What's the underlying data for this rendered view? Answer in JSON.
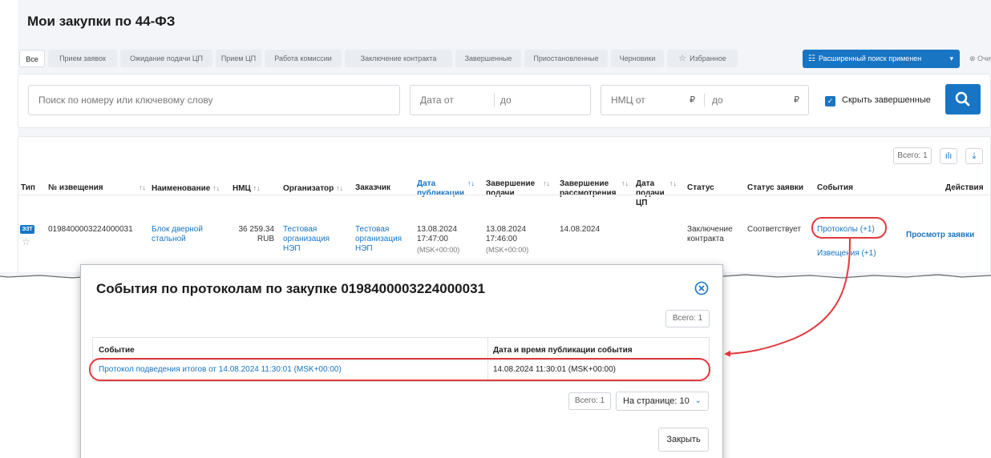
{
  "page": {
    "title": "Мои закупки по 44-ФЗ",
    "tabs": [
      {
        "label": "Все",
        "active": true
      },
      {
        "label": "Прием заявок"
      },
      {
        "label": "Ожидание подачи ЦП"
      },
      {
        "label": "Прием ЦП"
      },
      {
        "label": "Работа комиссии"
      },
      {
        "label": "Заключение контракта"
      },
      {
        "label": "Завершенные"
      },
      {
        "label": "Приостановленные"
      },
      {
        "label": "Черновики"
      },
      {
        "label": "Избранное",
        "icon": "star-icon"
      }
    ],
    "advanced_search_label": "Расширенный поиск применен",
    "clear_label": "Очистить"
  },
  "filters": {
    "search_placeholder": "Поиск по номеру или ключевому слову",
    "date_from": "Дата от",
    "date_to": "до",
    "nmc_from": "НМЦ от",
    "nmc_to": "до",
    "currency_symbol": "₽",
    "hide_completed_label": "Скрыть завершенные",
    "hide_completed_checked": true
  },
  "table": {
    "total_label": "Всего: 1",
    "headers": {
      "type": "Тип",
      "notice": "№ извещения",
      "name": "Наименование",
      "nmc": "НМЦ",
      "organizer": "Организатор",
      "customer": "Заказчик",
      "publish_date": "Дата публикации",
      "submission_end": "Завершение подачи",
      "review_end": "Завершение рассмотрения",
      "cp_date": "Дата подачи ЦП",
      "status": "Статус",
      "app_status": "Статус заявки",
      "events": "События",
      "actions": "Действия"
    },
    "row": {
      "type_badge": "ЭЗТ",
      "notice": "0198400003224000031",
      "name": "Блок дверной стальной",
      "nmc": "36 259.34",
      "currency": "RUB",
      "organizer": "Тестовая организация НЭП",
      "customer": "Тестовая организация НЭП",
      "publish_date": "13.08.2024",
      "publish_time": "17:47:00",
      "publish_tz": "(MSK+00:00)",
      "submission_date": "13.08.2024",
      "submission_time": "17:46:00",
      "submission_tz": "(MSK+00:00)",
      "review_end": "14.08.2024",
      "status": "Заключение контракта",
      "app_status": "Соответствует",
      "events_protocols": "Протоколы (+1)",
      "events_notices": "Извещения (+1)",
      "action": "Просмотр заявки"
    }
  },
  "modal": {
    "title": "События по протоколам по закупке 0198400003224000031",
    "total_label": "Всего: 1",
    "col_event": "Событие",
    "col_datetime": "Дата и время публикации события",
    "row_event": "Протокол подведения итогов от 14.08.2024 11:30:01 (MSK+00:00)",
    "row_datetime": "14.08.2024 11:30:01 (MSK+00:00)",
    "per_page_label": "На странице: 10",
    "close_label": "Закрыть"
  },
  "colors": {
    "accent": "#1775c4",
    "annotation_red": "#e0393e"
  }
}
